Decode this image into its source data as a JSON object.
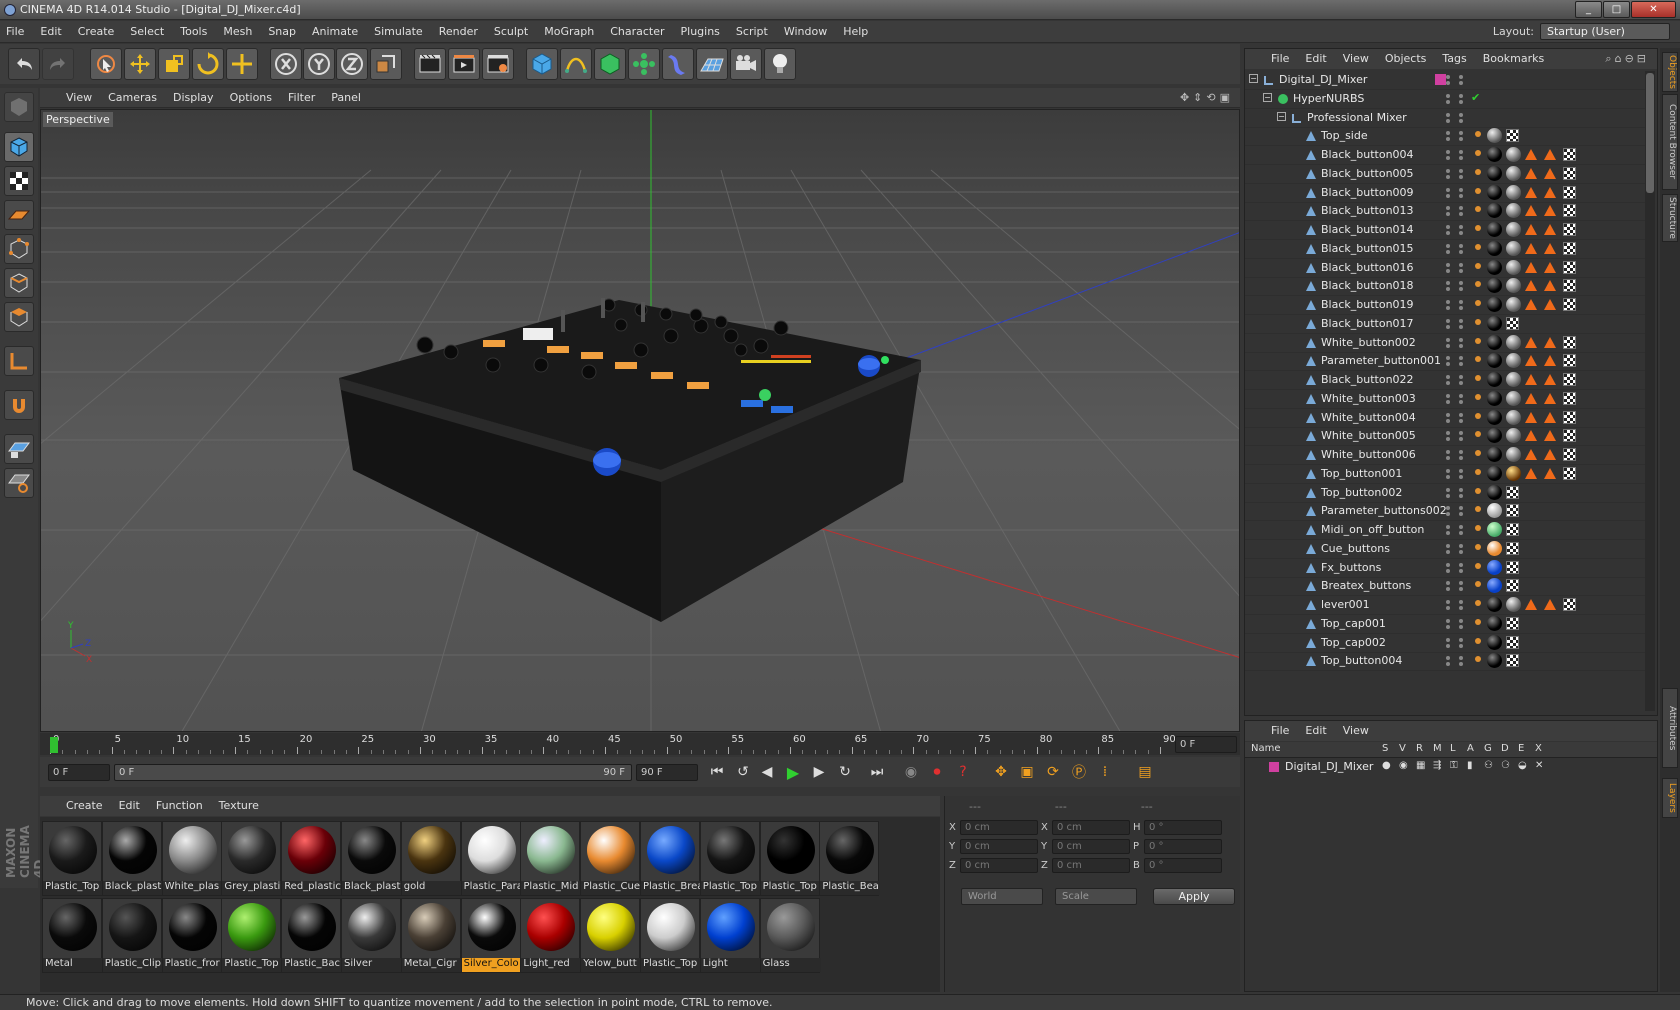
{
  "window": {
    "title": "CINEMA 4D R14.014 Studio - [Digital_DJ_Mixer.c4d]",
    "min": "_",
    "max": "□",
    "close": "✕"
  },
  "menu": [
    "File",
    "Edit",
    "Create",
    "Select",
    "Tools",
    "Mesh",
    "Snap",
    "Animate",
    "Simulate",
    "Render",
    "Sculpt",
    "MoGraph",
    "Character",
    "Plugins",
    "Script",
    "Window",
    "Help"
  ],
  "layout": {
    "label": "Layout:",
    "value": "Startup (User)"
  },
  "viewport": {
    "menu": [
      "View",
      "Cameras",
      "Display",
      "Options",
      "Filter",
      "Panel"
    ],
    "label": "Perspective"
  },
  "timeline": {
    "ticks": [
      "0",
      "5",
      "10",
      "15",
      "20",
      "25",
      "30",
      "35",
      "40",
      "45",
      "50",
      "55",
      "60",
      "65",
      "70",
      "75",
      "80",
      "85",
      "90"
    ],
    "current_frame": "0 F",
    "start": "0 F",
    "range_start": "0 F",
    "range_end": "90 F",
    "end": "90 F"
  },
  "materials": {
    "menu": [
      "Create",
      "Edit",
      "Function",
      "Texture"
    ],
    "row1": [
      {
        "name": "Plastic_Top",
        "color": "#1a1a1a",
        "hl": "#666"
      },
      {
        "name": "Black_plast",
        "color": "#050505",
        "hl": "#aaa"
      },
      {
        "name": "White_plas",
        "color": "#8a8a8a",
        "hl": "#eee"
      },
      {
        "name": "Grey_plasti",
        "color": "#2a2a2a",
        "hl": "#999"
      },
      {
        "name": "Red_plastic",
        "color": "#6a0008",
        "hl": "#f66"
      },
      {
        "name": "Black_plast",
        "color": "#0a0a0a",
        "hl": "#888"
      },
      {
        "name": "gold",
        "color": "#4a3410",
        "hl": "#f0d080"
      },
      {
        "name": "Plastic_Para",
        "color": "#ddd",
        "hl": "#fff"
      },
      {
        "name": "Plastic_Mid",
        "color": "#8ab890",
        "hl": "#eef"
      },
      {
        "name": "Plastic_Cue",
        "color": "#e88a30",
        "hl": "#fff"
      },
      {
        "name": "Plastic_Brea",
        "color": "#0a48c8",
        "hl": "#7af"
      },
      {
        "name": "Plastic_Top",
        "color": "#151515",
        "hl": "#777"
      },
      {
        "name": "Plastic_Top",
        "color": "#000",
        "hl": "#333"
      },
      {
        "name": "Plastic_Bea",
        "color": "#080808",
        "hl": "#666"
      }
    ],
    "row2": [
      {
        "name": "Metal",
        "color": "#0a0a0a",
        "hl": "#666"
      },
      {
        "name": "Plastic_Clip",
        "color": "#151515",
        "hl": "#555"
      },
      {
        "name": "Plastic_fror",
        "color": "#050505",
        "hl": "#888"
      },
      {
        "name": "Plastic_Top",
        "color": "#3a9a10",
        "hl": "#aef070"
      },
      {
        "name": "Plastic_Bac",
        "color": "#050505",
        "hl": "#999"
      },
      {
        "name": "Silver",
        "color": "#3a3a3a",
        "hl": "#eee"
      },
      {
        "name": "Metal_Cigr",
        "color": "#4a4035",
        "hl": "#d8ccb8"
      },
      {
        "name": "Silver_Colo",
        "color": "#0a0a0a",
        "hl": "#fff",
        "selected": true
      },
      {
        "name": "Light_red",
        "color": "#aa0000",
        "hl": "#ff5050"
      },
      {
        "name": "Yelow_butt",
        "color": "#d8d000",
        "hl": "#ffff80"
      },
      {
        "name": "Plastic_Top",
        "color": "#ccc",
        "hl": "#fff"
      },
      {
        "name": "Light",
        "color": "#0040d0",
        "hl": "#60a0ff"
      },
      {
        "name": "Glass",
        "color": "#5a5a5a",
        "hl": "#999"
      }
    ]
  },
  "coordinates": {
    "rows": [
      {
        "a": "X",
        "av": "0 cm",
        "b": "X",
        "bv": "0 cm",
        "c": "H",
        "cv": "0 °"
      },
      {
        "a": "Y",
        "av": "0 cm",
        "b": "Y",
        "bv": "0 cm",
        "c": "P",
        "cv": "0 °"
      },
      {
        "a": "Z",
        "av": "0 cm",
        "b": "Z",
        "bv": "0 cm",
        "c": "B",
        "cv": "0 °"
      }
    ],
    "mode": "World",
    "size_mode": "Scale",
    "apply": "Apply",
    "sep1": "---",
    "sep2": "---",
    "sep3": "---"
  },
  "objects": {
    "menu": [
      "File",
      "Edit",
      "View",
      "Objects",
      "Tags",
      "Bookmarks"
    ],
    "items": [
      {
        "name": "Digital_DJ_Mixer",
        "level": 0,
        "kind": "null"
      },
      {
        "name": "HyperNURBS",
        "level": 1,
        "kind": "nurbs"
      },
      {
        "name": "Professional Mixer",
        "level": 2,
        "kind": "null"
      },
      {
        "name": "Top_side",
        "level": 3,
        "kind": "poly",
        "tags": "sc"
      },
      {
        "name": "Black_button004",
        "level": 3,
        "kind": "poly",
        "tags": "bsttc"
      },
      {
        "name": "Black_button005",
        "level": 3,
        "kind": "poly",
        "tags": "bsttc"
      },
      {
        "name": "Black_button009",
        "level": 3,
        "kind": "poly",
        "tags": "bsttc"
      },
      {
        "name": "Black_button013",
        "level": 3,
        "kind": "poly",
        "tags": "bsttc"
      },
      {
        "name": "Black_button014",
        "level": 3,
        "kind": "poly",
        "tags": "bsttc"
      },
      {
        "name": "Black_button015",
        "level": 3,
        "kind": "poly",
        "tags": "bsttc"
      },
      {
        "name": "Black_button016",
        "level": 3,
        "kind": "poly",
        "tags": "bsttc"
      },
      {
        "name": "Black_button018",
        "level": 3,
        "kind": "poly",
        "tags": "bsttc"
      },
      {
        "name": "Black_button019",
        "level": 3,
        "kind": "poly",
        "tags": "bsttc"
      },
      {
        "name": "Black_button017",
        "level": 3,
        "kind": "poly",
        "tags": "bc"
      },
      {
        "name": "White_button002",
        "level": 3,
        "kind": "poly",
        "tags": "bsttc"
      },
      {
        "name": "Parameter_button001",
        "level": 3,
        "kind": "poly",
        "tags": "bsttc"
      },
      {
        "name": "Black_button022",
        "level": 3,
        "kind": "poly",
        "tags": "bsttc"
      },
      {
        "name": "White_button003",
        "level": 3,
        "kind": "poly",
        "tags": "bsttc"
      },
      {
        "name": "White_button004",
        "level": 3,
        "kind": "poly",
        "tags": "bsttc"
      },
      {
        "name": "White_button005",
        "level": 3,
        "kind": "poly",
        "tags": "bsttc"
      },
      {
        "name": "White_button006",
        "level": 3,
        "kind": "poly",
        "tags": "bsttc"
      },
      {
        "name": "Top_button001",
        "level": 3,
        "kind": "poly",
        "tags": "bgttc"
      },
      {
        "name": "Top_button002",
        "level": 3,
        "kind": "poly",
        "tags": "bc"
      },
      {
        "name": "Parameter_buttons002",
        "level": 3,
        "kind": "poly",
        "tags": "wc"
      },
      {
        "name": "Midi_on_off_button",
        "level": 3,
        "kind": "poly",
        "tags": "mc"
      },
      {
        "name": "Cue_buttons",
        "level": 3,
        "kind": "poly",
        "tags": "oc"
      },
      {
        "name": "Fx_buttons",
        "level": 3,
        "kind": "poly",
        "tags": "uc"
      },
      {
        "name": "Breatex_buttons",
        "level": 3,
        "kind": "poly",
        "tags": "uc"
      },
      {
        "name": "lever001",
        "level": 3,
        "kind": "poly",
        "tags": "bsttc"
      },
      {
        "name": "Top_cap001",
        "level": 3,
        "kind": "poly",
        "tags": "bc"
      },
      {
        "name": "Top_cap002",
        "level": 3,
        "kind": "poly",
        "tags": "bc"
      },
      {
        "name": "Top_button004",
        "level": 3,
        "kind": "poly",
        "tags": "bc"
      }
    ]
  },
  "layers": {
    "menu": [
      "File",
      "Edit",
      "View"
    ],
    "columns": [
      "Name",
      "S",
      "V",
      "R",
      "M",
      "L",
      "A",
      "G",
      "D",
      "E",
      "X"
    ],
    "items": [
      {
        "name": "Digital_DJ_Mixer",
        "color": "#d040a0"
      }
    ]
  },
  "side_tabs": [
    "Objects",
    "Content Browser",
    "Structure",
    "Attributes",
    "Layers"
  ],
  "status": "Move: Click and drag to move elements. Hold down SHIFT to quantize movement / add to the selection in point mode, CTRL to remove.",
  "brand": "MAXON CINEMA 4D",
  "colors": {
    "accent": "#f0a020",
    "axis_x": "#c03030",
    "axis_y": "#30c030",
    "axis_z": "#3040c0"
  }
}
